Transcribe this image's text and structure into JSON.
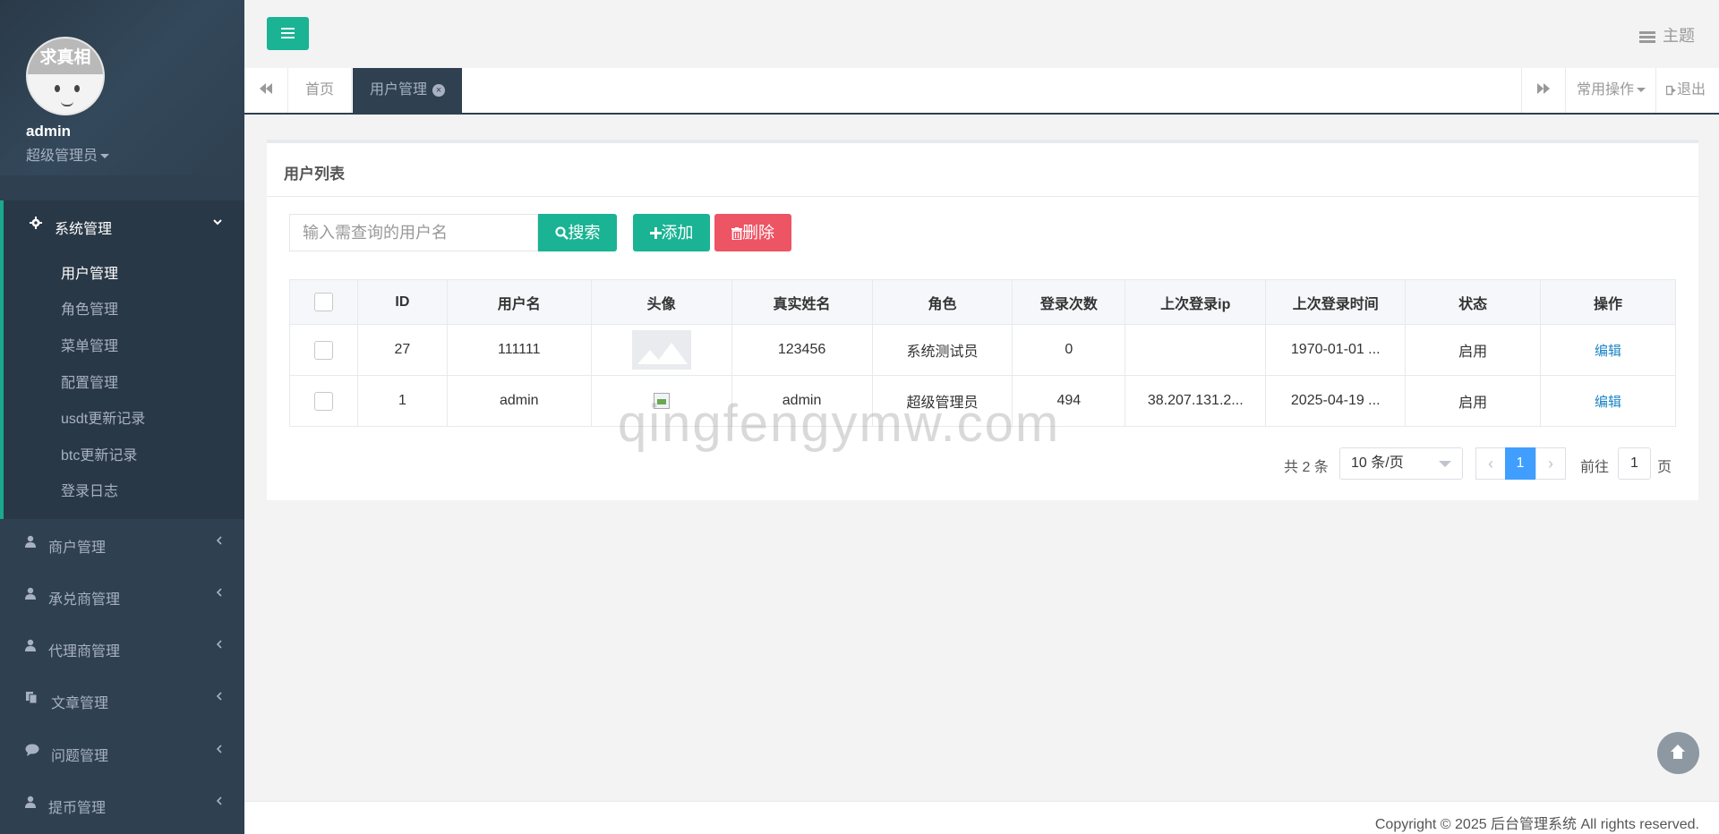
{
  "sidebar": {
    "avatar_text": "求真相",
    "user_name": "admin",
    "user_role": "超级管理员",
    "open_group": {
      "label": "系统管理",
      "icon": "gear-icon",
      "items": [
        {
          "label": "用户管理"
        },
        {
          "label": "角色管理"
        },
        {
          "label": "菜单管理"
        },
        {
          "label": "配置管理"
        },
        {
          "label": "usdt更新记录"
        },
        {
          "label": "btc更新记录"
        },
        {
          "label": "登录日志"
        }
      ]
    },
    "groups": [
      {
        "label": "商户管理",
        "icon": "user-icon"
      },
      {
        "label": "承兑商管理",
        "icon": "user-icon"
      },
      {
        "label": "代理商管理",
        "icon": "user-icon"
      },
      {
        "label": "文章管理",
        "icon": "copy-icon"
      },
      {
        "label": "问题管理",
        "icon": "comment-icon"
      },
      {
        "label": "提币管理",
        "icon": "user-icon"
      }
    ]
  },
  "topbar": {
    "theme_label": "主题"
  },
  "tabs": {
    "home": "首页",
    "current": "用户管理",
    "common_ops": "常用操作",
    "logout": "退出"
  },
  "panel": {
    "title": "用户列表",
    "search_placeholder": "输入需查询的用户名",
    "search_label": "搜索",
    "add_label": "添加",
    "delete_label": "删除"
  },
  "table": {
    "headers": [
      "ID",
      "用户名",
      "头像",
      "真实姓名",
      "角色",
      "登录次数",
      "上次登录ip",
      "上次登录时间",
      "状态",
      "操作"
    ],
    "rows": [
      {
        "id": "27",
        "username": "111111",
        "real_name": "123456",
        "role": "系统测试员",
        "login_count": "0",
        "last_ip": "",
        "last_time": "1970-01-01 ...",
        "status": "启用",
        "action": "编辑"
      },
      {
        "id": "1",
        "username": "admin",
        "real_name": "admin",
        "role": "超级管理员",
        "login_count": "494",
        "last_ip": "38.207.131.2...",
        "last_time": "2025-04-19 ...",
        "status": "启用",
        "action": "编辑"
      }
    ]
  },
  "pagination": {
    "total": "共 2 条",
    "page_size": "10 条/页",
    "current_page": "1",
    "goto_prefix": "前往",
    "goto_value": "1",
    "goto_suffix": "页"
  },
  "watermark": "qingfengymw.com",
  "footer": "Copyright © 2025 后台管理系统 All rights reserved.",
  "colors": {
    "sidebar_bg": "#2f4050",
    "accent_green": "#1ab394",
    "danger_red": "#ed5565",
    "link_blue": "#1c84c6",
    "page_blue": "#409eff"
  }
}
